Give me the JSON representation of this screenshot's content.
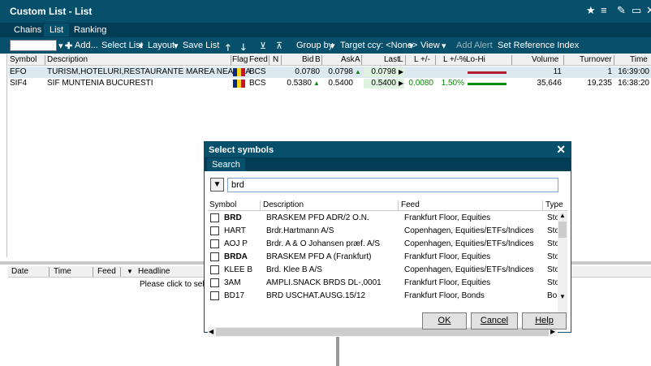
{
  "window": {
    "title": "Custom List - List"
  },
  "title_icons": [
    "star-icon",
    "menu-icon",
    "wrench-icon",
    "restore-icon",
    "close-icon"
  ],
  "tabs": [
    "Chains",
    "List",
    "Ranking"
  ],
  "toolbar": {
    "add_label": "Add...",
    "select_list_label": "Select List",
    "layout_label": "Layout",
    "save_list_label": "Save List",
    "group_by_label": "Group by",
    "target_ccy_label": "Target ccy: <None>",
    "view_label": "View",
    "add_alert_label": "Add Alert",
    "set_reference_label": "Set Reference Index"
  },
  "grid": {
    "columns": [
      "Symbol",
      "Description",
      "Flag",
      "Feed",
      "N",
      "Bid",
      "B",
      "Ask",
      "A",
      "Last",
      "L",
      "L +/-",
      "L +/-%",
      "Lo-Hi",
      "Volume",
      "Turnover",
      "Time"
    ],
    "rows": [
      {
        "symbol": "EFO",
        "description": "TURISM,HOTELURI,RESTAURANTE MAREA NEAGRA",
        "feed": "BCS",
        "bid": "0.0780",
        "ask": "0.0798",
        "last": "0.0798",
        "change": "",
        "change_pct": "",
        "volume": "11",
        "turnover": "1",
        "time": "16:39:00"
      },
      {
        "symbol": "SIF4",
        "description": "SIF MUNTENIA BUCURESTI",
        "feed": "BCS",
        "bid": "0.5380",
        "ask": "0.5400",
        "last": "0.5400",
        "change": "0.0080",
        "change_pct": "1.50%",
        "volume": "35,646",
        "turnover": "19,235",
        "time": "16:38:20"
      }
    ]
  },
  "news": {
    "columns": [
      "Date",
      "Time",
      "Feed",
      "Headline"
    ],
    "hint": "Please click to selec"
  },
  "dialog": {
    "title": "Select symbols",
    "tab": "Search",
    "search_value": "brd",
    "columns": [
      "Symbol",
      "Description",
      "Feed",
      "Type"
    ],
    "results": [
      {
        "symbol": "BRD",
        "description": "BRASKEM PFD ADR/2 O.N.",
        "feed": "Frankfurt Floor, Equities",
        "type": "Sto"
      },
      {
        "symbol": "HART",
        "description": "Brdr.Hartmann A/S",
        "feed": "Copenhagen, Equities/ETFs/Indices",
        "type": "Sto"
      },
      {
        "symbol": "AOJ P",
        "description": "Brdr. A & O Johansen præf. A/S",
        "feed": "Copenhagen, Equities/ETFs/Indices",
        "type": "Sto"
      },
      {
        "symbol": "BRDA",
        "description": "BRASKEM PFD A (Frankfurt)",
        "feed": "Frankfurt Floor, Equities",
        "type": "Sto"
      },
      {
        "symbol": "KLEE B",
        "description": "Brd. Klee B A/S",
        "feed": "Copenhagen, Equities/ETFs/Indices",
        "type": "Sto"
      },
      {
        "symbol": "3AM",
        "description": "AMPLI.SNACK BRDS DL-,0001",
        "feed": "Frankfurt Floor, Equities",
        "type": "Sto"
      },
      {
        "symbol": "BD17",
        "description": "BRD USCHAT.AUSG.15/12",
        "feed": "Frankfurt Floor, Bonds",
        "type": "Bo"
      }
    ],
    "ok_label": "OK",
    "cancel_label": "Cancel",
    "help_label": "Help"
  },
  "colors": {
    "titlebar": "#06506c",
    "tabbar": "#033d55",
    "up": "#0a8a0a",
    "down": "#b01c2c",
    "flag_blue": "#002b7f",
    "flag_yellow": "#fcd116",
    "flag_red": "#ce1126"
  }
}
